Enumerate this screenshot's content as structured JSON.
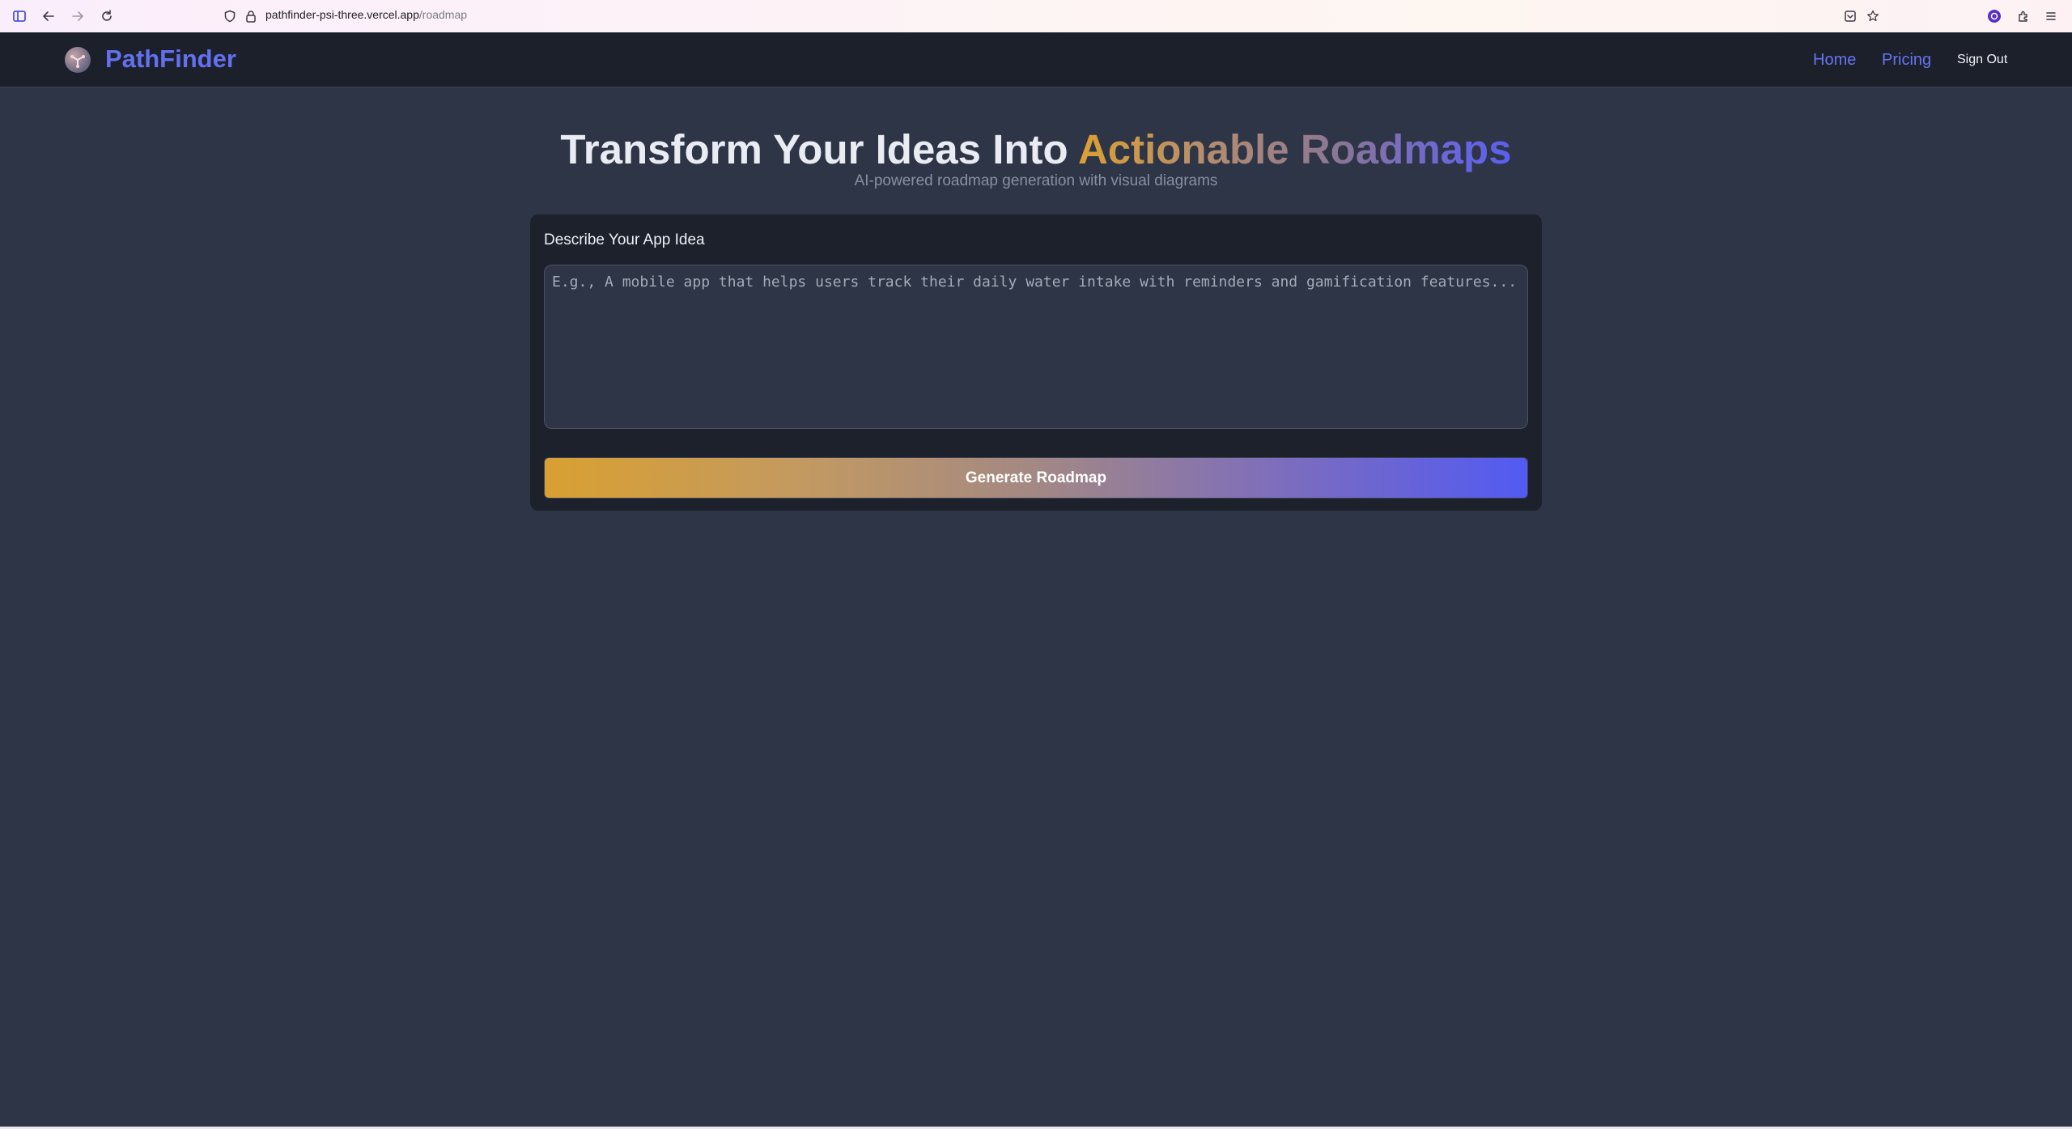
{
  "browser": {
    "url_host": "pathfinder-psi-three.vercel.app",
    "url_path": "/roadmap"
  },
  "navbar": {
    "brand": "PathFinder",
    "links": [
      {
        "label": "Home"
      },
      {
        "label": "Pricing"
      }
    ],
    "sign_out": "Sign Out"
  },
  "hero": {
    "title_plain": "Transform Your Ideas Into ",
    "title_highlight": "Actionable Roadmaps",
    "subtitle": "AI-powered roadmap generation with visual diagrams"
  },
  "form": {
    "label": "Describe Your App Idea",
    "value": "",
    "placeholder": "E.g., A mobile app that helps users track their daily water intake with reminders and gamification features...",
    "submit_label": "Generate Roadmap"
  },
  "colors": {
    "brand": "#6470ee",
    "page_bg": "#2e3546",
    "navbar_bg": "#1b202b",
    "card_bg": "#1c212c",
    "gradient_start": "#dca033",
    "gradient_end": "#5b5ff0"
  },
  "icons": {
    "sidebar": "sidebar-toggle-icon",
    "back": "back-arrow-icon",
    "forward": "forward-arrow-icon",
    "reload": "reload-icon",
    "tracking": "shield-icon",
    "lock": "lock-icon",
    "save_page": "save-to-pocket-icon",
    "bookmark": "star-icon",
    "account": "account-icon",
    "extensions": "extensions-icon",
    "menu": "hamburger-menu-icon",
    "logo": "pathfinder-logo-icon"
  }
}
